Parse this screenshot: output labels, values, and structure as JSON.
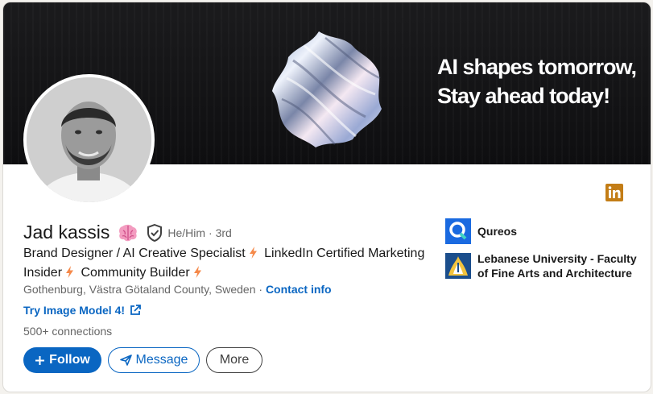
{
  "banner": {
    "line1": "AI shapes tomorrow,",
    "line2": "Stay ahead today!"
  },
  "profile": {
    "name": "Jad kassis",
    "pronouns": "He/Him",
    "degree": "· 3rd",
    "headline_parts": [
      "Brand Designer / AI Creative Specialist",
      "LinkedIn Certified Marketing Insider",
      "Community Builder"
    ],
    "location": "Gothenburg, Västra Götaland County, Sweden",
    "location_sep": " · ",
    "contact_label": "Contact info",
    "website_label": "Try Image Model 4!",
    "connections": "500+ connections"
  },
  "actions": {
    "follow_label": "Follow",
    "message_label": "Message",
    "more_label": "More"
  },
  "experience": [
    {
      "name": "Qureos",
      "logo_color": "#1a6ae0"
    },
    {
      "name": "Lebanese University - Faculty of Fine Arts and Architecture",
      "logo_color": "#1b4e8c"
    }
  ],
  "colors": {
    "accent": "#0a66c2",
    "linkedin_badge": "#c37d16"
  },
  "icons": [
    "brain-icon",
    "verified-shield-icon",
    "lightning-icon",
    "external-link-icon",
    "plus-icon",
    "send-icon",
    "linkedin-icon"
  ]
}
